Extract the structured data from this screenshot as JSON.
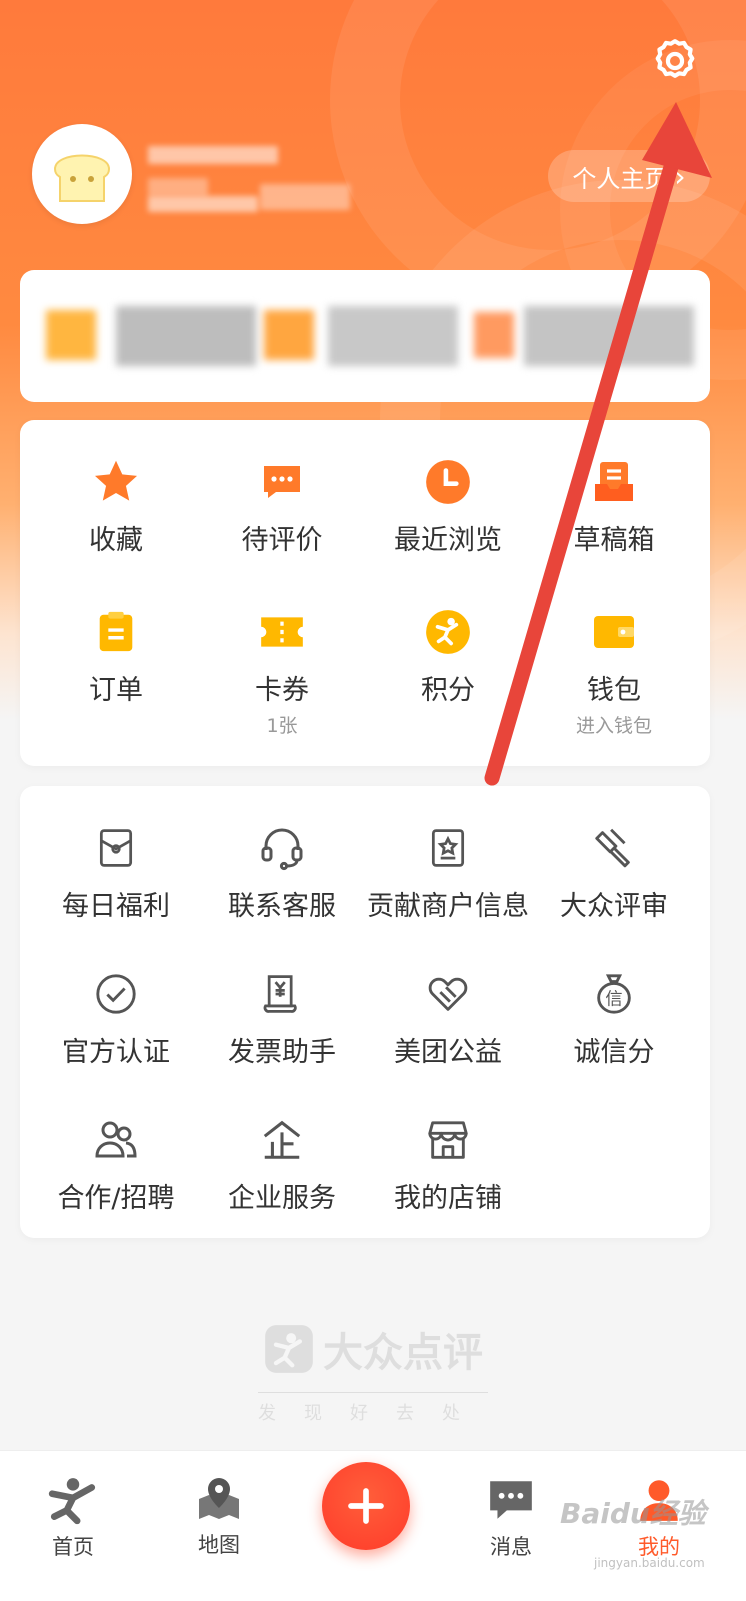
{
  "colors": {
    "brand_orange": "#ff7a3c",
    "accent_red": "#ff3b2a",
    "icon_yellow": "#ffb800",
    "icon_orange": "#ff8a2a"
  },
  "header": {
    "profile_button_label": "个人主页",
    "profile_button_chevron": "›"
  },
  "quick_grid": [
    {
      "label": "收藏",
      "icon": "star-icon"
    },
    {
      "label": "待评价",
      "icon": "comment-icon"
    },
    {
      "label": "最近浏览",
      "icon": "clock-icon"
    },
    {
      "label": "草稿箱",
      "icon": "draft-box-icon"
    },
    {
      "label": "订单",
      "icon": "order-icon"
    },
    {
      "label": "卡券",
      "icon": "ticket-icon",
      "sub": "1张"
    },
    {
      "label": "积分",
      "icon": "points-icon"
    },
    {
      "label": "钱包",
      "icon": "wallet-icon",
      "sub": "进入钱包"
    }
  ],
  "service_grid": [
    {
      "label": "每日福利",
      "icon": "red-envelope-icon"
    },
    {
      "label": "联系客服",
      "icon": "headset-icon"
    },
    {
      "label": "贡献商户信息",
      "icon": "merchant-info-icon"
    },
    {
      "label": "大众评审",
      "icon": "gavel-icon"
    },
    {
      "label": "官方认证",
      "icon": "check-circle-icon"
    },
    {
      "label": "发票助手",
      "icon": "invoice-icon"
    },
    {
      "label": "美团公益",
      "icon": "charity-heart-icon"
    },
    {
      "label": "诚信分",
      "icon": "credit-bag-icon"
    },
    {
      "label": "合作/招聘",
      "icon": "people-icon"
    },
    {
      "label": "企业服务",
      "icon": "enterprise-icon"
    },
    {
      "label": "我的店铺",
      "icon": "store-icon"
    }
  ],
  "brand": {
    "name": "大众点评",
    "slogan": "发现好去处"
  },
  "tabbar": [
    {
      "label": "首页",
      "icon": "home-icon"
    },
    {
      "label": "地图",
      "icon": "map-icon"
    },
    {
      "label": "",
      "icon": "plus-icon"
    },
    {
      "label": "消息",
      "icon": "message-icon"
    },
    {
      "label": "我的",
      "icon": "profile-icon",
      "active": true
    }
  ],
  "watermark": {
    "text": "Baidu经验",
    "sub": "jingyan.baidu.com"
  }
}
